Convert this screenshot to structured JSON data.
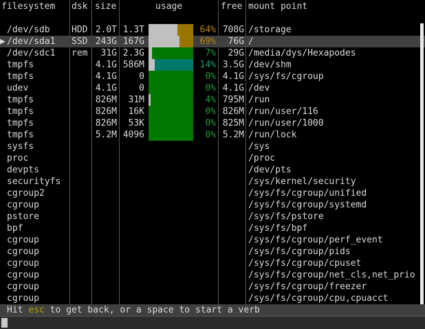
{
  "headers": {
    "filesystem": "filesystem",
    "dsk": "dsk",
    "size": "size",
    "usage": "usage",
    "free": "free",
    "mount": "mount point"
  },
  "rows": [
    {
      "fs": "/dev/sdb",
      "dsk": "HDD",
      "size": "2.0T",
      "used": "1.3T",
      "pct": "64%",
      "free": "708G",
      "mount": "/storage",
      "usage": 0.64,
      "style": "warn",
      "selected": false
    },
    {
      "fs": "/dev/sda1",
      "dsk": "SSD",
      "size": "243G",
      "used": "167G",
      "pct": "69%",
      "free": "76G",
      "mount": "/",
      "usage": 0.69,
      "style": "warn",
      "selected": true
    },
    {
      "fs": "/dev/sdc1",
      "dsk": "rem",
      "size": "31G",
      "used": "2.3G",
      "pct": "7%",
      "free": "29G",
      "mount": "/media/dys/Hexapodes",
      "usage": 0.07,
      "style": "ok",
      "selected": false
    },
    {
      "fs": "tmpfs",
      "dsk": "",
      "size": "4.1G",
      "used": "586M",
      "pct": "14%",
      "free": "3.5G",
      "mount": "/dev/shm",
      "usage": 0.14,
      "style": "shm",
      "selected": false
    },
    {
      "fs": "tmpfs",
      "dsk": "",
      "size": "4.1G",
      "used": "0",
      "pct": "0%",
      "free": "4.1G",
      "mount": "/sys/fs/cgroup",
      "usage": 0.0,
      "style": "ok",
      "selected": false
    },
    {
      "fs": "udev",
      "dsk": "",
      "size": "4.1G",
      "used": "0",
      "pct": "0%",
      "free": "4.1G",
      "mount": "/dev",
      "usage": 0.0,
      "style": "ok",
      "selected": false
    },
    {
      "fs": "tmpfs",
      "dsk": "",
      "size": "826M",
      "used": "31M",
      "pct": "4%",
      "free": "795M",
      "mount": "/run",
      "usage": 0.04,
      "style": "ok",
      "selected": false
    },
    {
      "fs": "tmpfs",
      "dsk": "",
      "size": "826M",
      "used": "16K",
      "pct": "0%",
      "free": "826M",
      "mount": "/run/user/116",
      "usage": 0.0,
      "style": "ok",
      "selected": false
    },
    {
      "fs": "tmpfs",
      "dsk": "",
      "size": "826M",
      "used": "53K",
      "pct": "0%",
      "free": "825M",
      "mount": "/run/user/1000",
      "usage": 0.0,
      "style": "ok",
      "selected": false
    },
    {
      "fs": "tmpfs",
      "dsk": "",
      "size": "5.2M",
      "used": "4096",
      "pct": "0%",
      "free": "5.2M",
      "mount": "/run/lock",
      "usage": 0.0,
      "style": "ok",
      "selected": false
    },
    {
      "fs": "sysfs",
      "dsk": "",
      "size": "",
      "used": "",
      "pct": "",
      "free": "",
      "mount": "/sys",
      "usage": null,
      "style": "none",
      "selected": false
    },
    {
      "fs": "proc",
      "dsk": "",
      "size": "",
      "used": "",
      "pct": "",
      "free": "",
      "mount": "/proc",
      "usage": null,
      "style": "none",
      "selected": false
    },
    {
      "fs": "devpts",
      "dsk": "",
      "size": "",
      "used": "",
      "pct": "",
      "free": "",
      "mount": "/dev/pts",
      "usage": null,
      "style": "none",
      "selected": false
    },
    {
      "fs": "securityfs",
      "dsk": "",
      "size": "",
      "used": "",
      "pct": "",
      "free": "",
      "mount": "/sys/kernel/security",
      "usage": null,
      "style": "none",
      "selected": false
    },
    {
      "fs": "cgroup2",
      "dsk": "",
      "size": "",
      "used": "",
      "pct": "",
      "free": "",
      "mount": "/sys/fs/cgroup/unified",
      "usage": null,
      "style": "none",
      "selected": false
    },
    {
      "fs": "cgroup",
      "dsk": "",
      "size": "",
      "used": "",
      "pct": "",
      "free": "",
      "mount": "/sys/fs/cgroup/systemd",
      "usage": null,
      "style": "none",
      "selected": false
    },
    {
      "fs": "pstore",
      "dsk": "",
      "size": "",
      "used": "",
      "pct": "",
      "free": "",
      "mount": "/sys/fs/pstore",
      "usage": null,
      "style": "none",
      "selected": false
    },
    {
      "fs": "bpf",
      "dsk": "",
      "size": "",
      "used": "",
      "pct": "",
      "free": "",
      "mount": "/sys/fs/bpf",
      "usage": null,
      "style": "none",
      "selected": false
    },
    {
      "fs": "cgroup",
      "dsk": "",
      "size": "",
      "used": "",
      "pct": "",
      "free": "",
      "mount": "/sys/fs/cgroup/perf_event",
      "usage": null,
      "style": "none",
      "selected": false
    },
    {
      "fs": "cgroup",
      "dsk": "",
      "size": "",
      "used": "",
      "pct": "",
      "free": "",
      "mount": "/sys/fs/cgroup/pids",
      "usage": null,
      "style": "none",
      "selected": false
    },
    {
      "fs": "cgroup",
      "dsk": "",
      "size": "",
      "used": "",
      "pct": "",
      "free": "",
      "mount": "/sys/fs/cgroup/cpuset",
      "usage": null,
      "style": "none",
      "selected": false
    },
    {
      "fs": "cgroup",
      "dsk": "",
      "size": "",
      "used": "",
      "pct": "",
      "free": "",
      "mount": "/sys/fs/cgroup/net_cls,net_prio",
      "usage": null,
      "style": "none",
      "selected": false
    },
    {
      "fs": "cgroup",
      "dsk": "",
      "size": "",
      "used": "",
      "pct": "",
      "free": "",
      "mount": "/sys/fs/cgroup/freezer",
      "usage": null,
      "style": "none",
      "selected": false
    },
    {
      "fs": "cgroup",
      "dsk": "",
      "size": "",
      "used": "",
      "pct": "",
      "free": "",
      "mount": "/sys/fs/cgroup/cpu,cpuacct",
      "usage": null,
      "style": "none",
      "selected": false
    }
  ],
  "selection_marker": "▶",
  "status": {
    "prefix": "Hit ",
    "key": "esc",
    "suffix": " to get back, or a space to start a verb"
  },
  "colors": {
    "background": "#000000",
    "selected_row": "#404040",
    "bar_free": "#007800",
    "bar_used": "#c0c0c0",
    "bar_warn": "#9a7400",
    "pct_warn": "#b8860b",
    "pct_ok": "#1f9b3a",
    "key_highlight": "#b8a000"
  }
}
